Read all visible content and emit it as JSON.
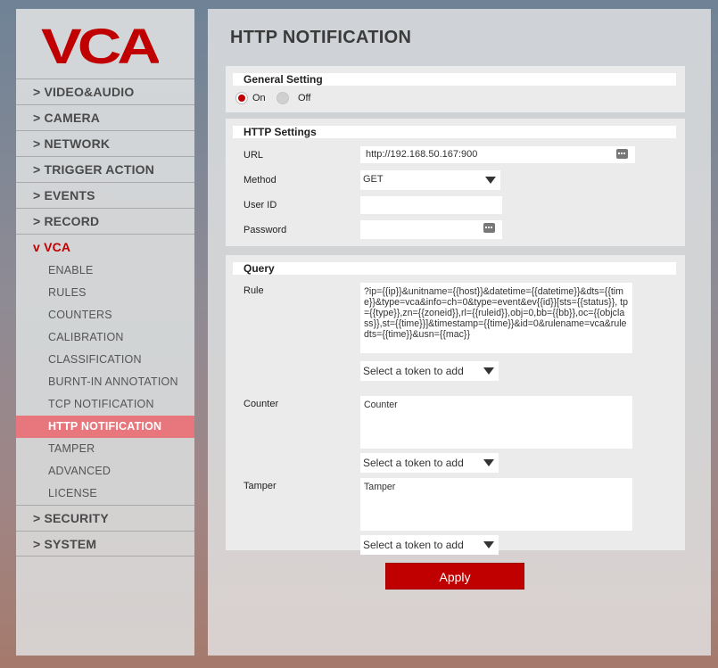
{
  "brand": {
    "logo_text": "VCA",
    "color": "#c00000"
  },
  "sidebar": {
    "main_before": [
      {
        "label": "> VIDEO&AUDIO"
      },
      {
        "label": "> CAMERA"
      },
      {
        "label": "> NETWORK"
      },
      {
        "label": "> TRIGGER ACTION"
      },
      {
        "label": "> EVENTS"
      },
      {
        "label": "> RECORD"
      }
    ],
    "vca": {
      "label": "v VCA"
    },
    "sub_items": [
      {
        "label": "ENABLE"
      },
      {
        "label": "RULES"
      },
      {
        "label": "COUNTERS"
      },
      {
        "label": "CALIBRATION"
      },
      {
        "label": "CLASSIFICATION"
      },
      {
        "label": "BURNT-IN ANNOTATION"
      },
      {
        "label": "TCP NOTIFICATION"
      },
      {
        "label": "HTTP NOTIFICATION",
        "active": true
      },
      {
        "label": "TAMPER"
      },
      {
        "label": "ADVANCED"
      },
      {
        "label": "LICENSE"
      }
    ],
    "main_after": [
      {
        "label": "> SECURITY"
      },
      {
        "label": "> SYSTEM"
      }
    ]
  },
  "page_title": "HTTP NOTIFICATION",
  "general": {
    "header": "General Setting",
    "on_label": "On",
    "off_label": "Off",
    "selected": "On"
  },
  "http": {
    "header": "HTTP Settings",
    "url_label": "URL",
    "url_value": "http://192.168.50.167:900",
    "method_label": "Method",
    "method_value": "GET",
    "userid_label": "User ID",
    "userid_value": "",
    "password_label": "Password",
    "password_value": ""
  },
  "query": {
    "header": "Query",
    "rule_label": "Rule",
    "rule_value": " ?ip={{ip}}&unitname={{host}}&datetime={{datetime}}&dts={{time}}&type=vca&info=ch=0&type=event&ev{{id}}[sts={{status}}, tp={{type}},zn={{zoneid}},rl={{ruleid}},obj=0,bb={{bb}},oc={{objclass}},st={{time}}]&timestamp={{time}}&id=0&rulename=vca&ruledts={{time}}&usn={{mac}}",
    "token_placeholder": "Select a token to add",
    "counter_label": "Counter",
    "counter_value": "Counter",
    "tamper_label": "Tamper",
    "tamper_value": "Tamper"
  },
  "apply_label": "Apply"
}
